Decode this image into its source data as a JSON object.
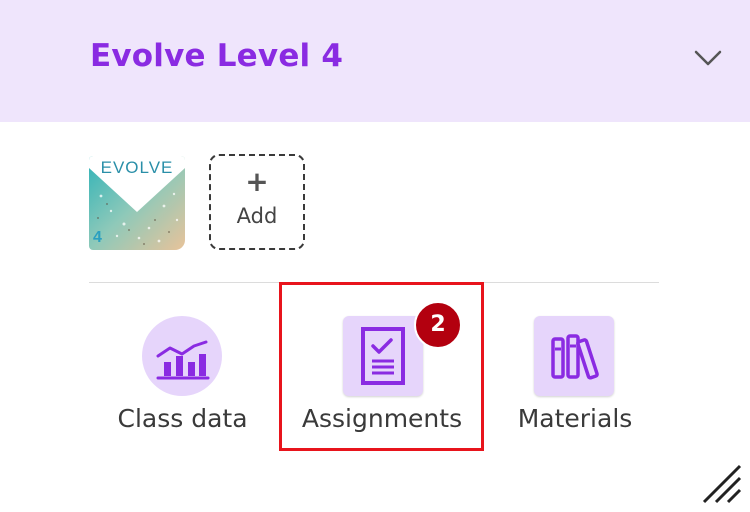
{
  "header": {
    "course_title": "Evolve Level 4",
    "toggle_icon": "chevron-down-icon"
  },
  "books": {
    "cover": {
      "brand": "EVOLVE",
      "level": "4"
    },
    "add_button": {
      "icon": "plus-icon",
      "label": "Add"
    }
  },
  "nav": {
    "class_data": {
      "label": "Class data",
      "icon": "bar-chart-icon"
    },
    "assignments": {
      "label": "Assignments",
      "icon": "checklist-icon",
      "badge_count": "2"
    },
    "materials": {
      "label": "Materials",
      "icon": "books-icon"
    }
  },
  "colors": {
    "accent": "#8a2be2",
    "header_bg": "#efe5fc",
    "icon_bg": "#e6d5fb",
    "badge": "#b3000f",
    "highlight": "#e8141c"
  }
}
